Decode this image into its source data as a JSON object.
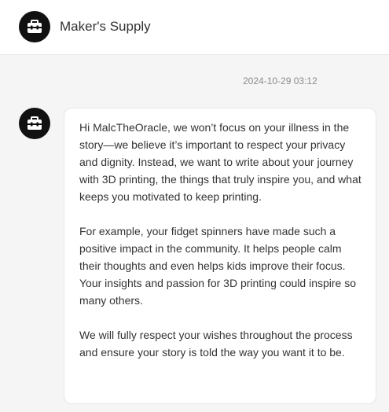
{
  "header": {
    "title": "Maker's Supply",
    "avatar_icon": "toolbox-icon"
  },
  "conversation": {
    "timestamp": "2024-10-29 03:12",
    "message": {
      "sender_avatar_icon": "toolbox-icon",
      "paragraphs": [
        "Hi MalcTheOracle, we won’t focus on your illness in the story—we believe it’s important to respect your privacy and dignity. Instead, we want to write about your journey with 3D printing, the things that truly inspire you, and what keeps you motivated to keep printing.",
        "For example, your fidget spinners have made such a positive impact in the community. It helps people calm their thoughts and even helps kids improve their focus. Your insights and passion for 3D printing could inspire so many others.",
        "We will fully respect your wishes throughout the process and ensure your story is told the way you want it to be."
      ]
    }
  },
  "colors": {
    "background": "#f5f5f5",
    "avatar": "#111111",
    "bubble": "#ffffff",
    "timestamp": "#8c8c8c"
  }
}
